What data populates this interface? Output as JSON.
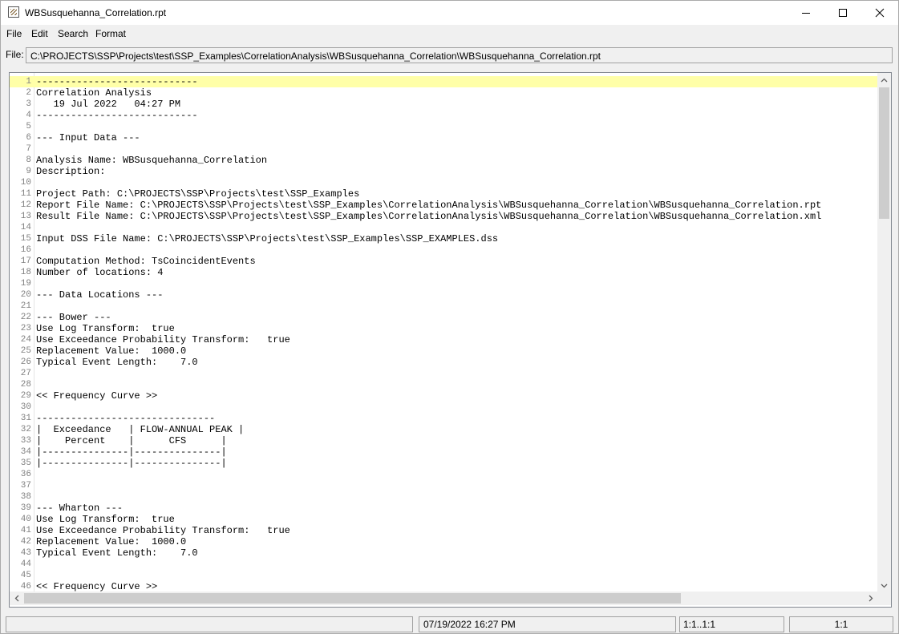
{
  "window": {
    "title": "WBSusquehanna_Correlation.rpt",
    "icon": "report-file-icon"
  },
  "menu": [
    "File",
    "Edit",
    "Search",
    "Format"
  ],
  "filebar": {
    "label": "File:",
    "path": "C:\\PROJECTS\\SSP\\Projects\\test\\SSP_Examples\\CorrelationAnalysis\\WBSusquehanna_Correlation\\WBSusquehanna_Correlation.rpt"
  },
  "editor": {
    "current_line": 1,
    "lines": [
      "----------------------------",
      "Correlation Analysis",
      "   19 Jul 2022   04:27 PM",
      "----------------------------",
      "",
      "--- Input Data ---",
      "",
      "Analysis Name: WBSusquehanna_Correlation",
      "Description:",
      "",
      "Project Path: C:\\PROJECTS\\SSP\\Projects\\test\\SSP_Examples",
      "Report File Name: C:\\PROJECTS\\SSP\\Projects\\test\\SSP_Examples\\CorrelationAnalysis\\WBSusquehanna_Correlation\\WBSusquehanna_Correlation.rpt",
      "Result File Name: C:\\PROJECTS\\SSP\\Projects\\test\\SSP_Examples\\CorrelationAnalysis\\WBSusquehanna_Correlation\\WBSusquehanna_Correlation.xml",
      "",
      "Input DSS File Name: C:\\PROJECTS\\SSP\\Projects\\test\\SSP_Examples\\SSP_EXAMPLES.dss",
      "",
      "Computation Method: TsCoincidentEvents",
      "Number of locations: 4",
      "",
      "--- Data Locations ---",
      "",
      "--- Bower ---",
      "Use Log Transform:  true",
      "Use Exceedance Probability Transform:   true",
      "Replacement Value:  1000.0",
      "Typical Event Length:    7.0",
      "",
      "",
      "<< Frequency Curve >>",
      "",
      "-------------------------------",
      "|  Exceedance   | FLOW-ANNUAL PEAK |",
      "|    Percent    |      CFS      |",
      "|---------------|---------------|",
      "|---------------|---------------|",
      "",
      "",
      "",
      "--- Wharton ---",
      "Use Log Transform:  true",
      "Use Exceedance Probability Transform:   true",
      "Replacement Value:  1000.0",
      "Typical Event Length:    7.0",
      "",
      "",
      "<< Frequency Curve >>"
    ]
  },
  "status": {
    "cell1": "",
    "datetime": "07/19/2022 16:27 PM",
    "position": "1:1..1:1",
    "line_col": "1:1"
  }
}
